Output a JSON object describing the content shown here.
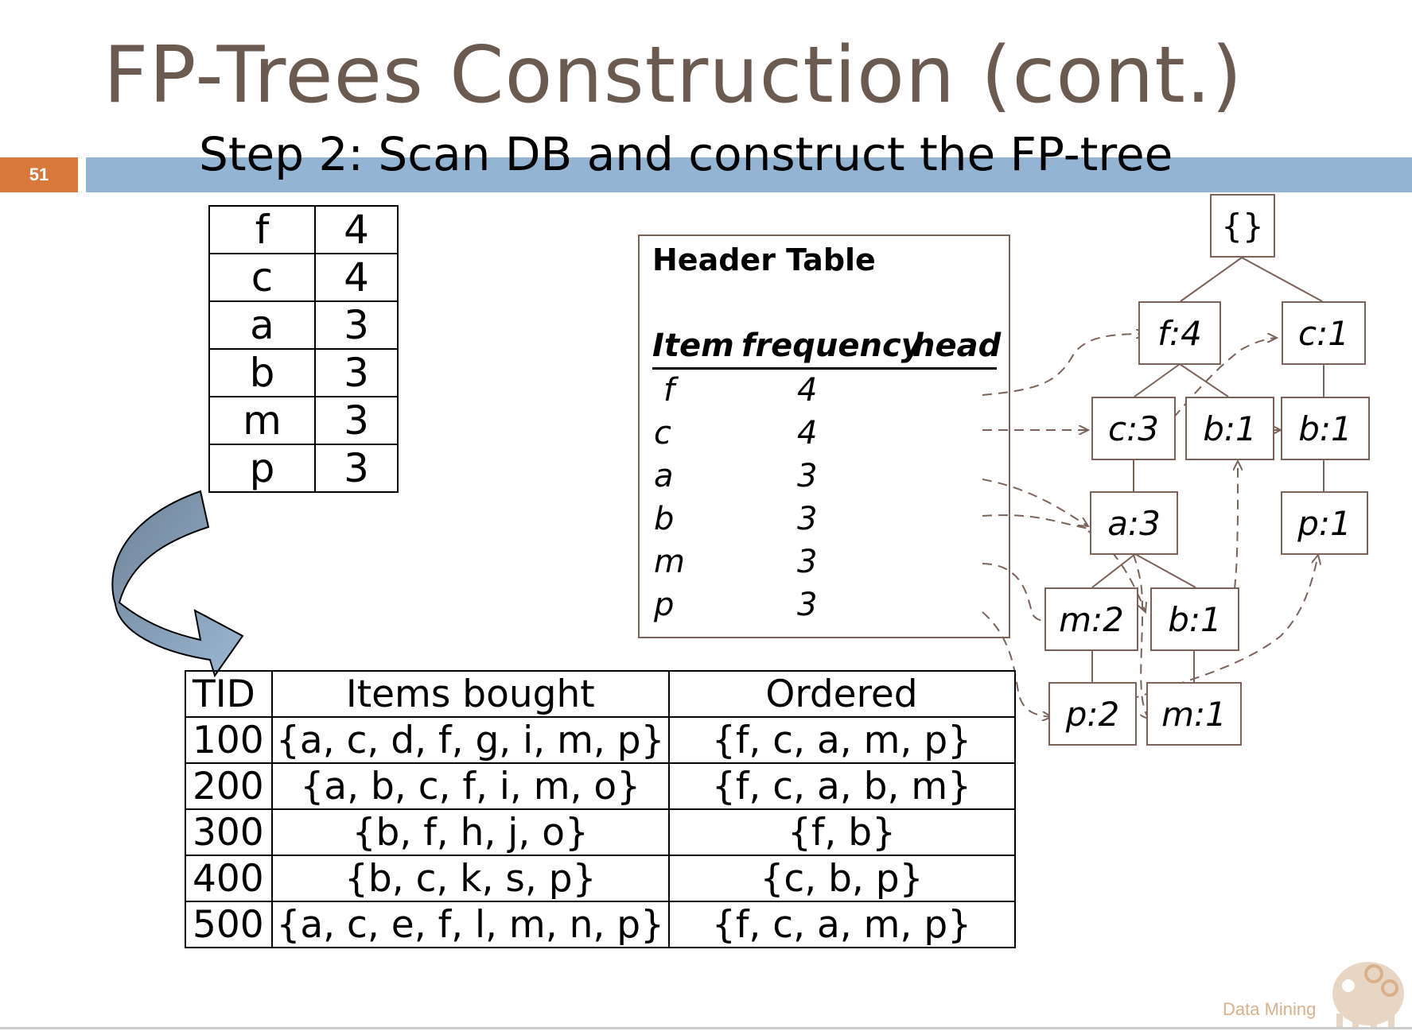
{
  "title": "FP-Trees Construction (cont.)",
  "slide_number": "51",
  "subtitle": "Step 2: Scan DB and construct the FP-tree",
  "frequency_table": [
    {
      "item": "f",
      "count": "4"
    },
    {
      "item": "c",
      "count": "4"
    },
    {
      "item": "a",
      "count": "3"
    },
    {
      "item": "b",
      "count": "3"
    },
    {
      "item": "m",
      "count": "3"
    },
    {
      "item": "p",
      "count": "3"
    }
  ],
  "transactions": {
    "headers": [
      "TID",
      "Items bought",
      "Ordered"
    ],
    "rows": [
      {
        "tid": "100",
        "items": "{a, c, d, f, g, i, m, p}",
        "ordered": "{f, c, a, m, p}"
      },
      {
        "tid": "200",
        "items": "{a, b, c, f, i, m, o}",
        "ordered": "{f, c, a, b, m}"
      },
      {
        "tid": "300",
        "items": "{b, f, h, j, o}",
        "ordered": "{f, b}"
      },
      {
        "tid": "400",
        "items": "{b, c, k, s, p}",
        "ordered": "{c, b, p}"
      },
      {
        "tid": "500",
        "items": "{a, c, e, f, l, m, n, p}",
        "ordered": "{f, c, a, m, p}"
      }
    ]
  },
  "header_table": {
    "title": "Header Table",
    "col_item": "Item",
    "col_frequency": "frequency",
    "col_head": "head",
    "rows": [
      {
        "item": "f",
        "frequency": "4"
      },
      {
        "item": "c",
        "frequency": "4"
      },
      {
        "item": "a",
        "frequency": "3"
      },
      {
        "item": "b",
        "frequency": "3"
      },
      {
        "item": "m",
        "frequency": "3"
      },
      {
        "item": "p",
        "frequency": "3"
      }
    ]
  },
  "tree": {
    "root": "{}",
    "f4": "f:4",
    "c1": "c:1",
    "c3": "c:3",
    "b1_a": "b:1",
    "b1_b": "b:1",
    "a3": "a:3",
    "p1_a": "p:1",
    "m2": "m:2",
    "b1_c": "b:1",
    "p2": "p:2",
    "m1": "m:1"
  },
  "watermark": "Data Mining",
  "colors": {
    "title": "#6b5a4f",
    "accent_orange": "#d9783b",
    "accent_blue": "#93b4d3",
    "node_border": "#7a6258"
  }
}
